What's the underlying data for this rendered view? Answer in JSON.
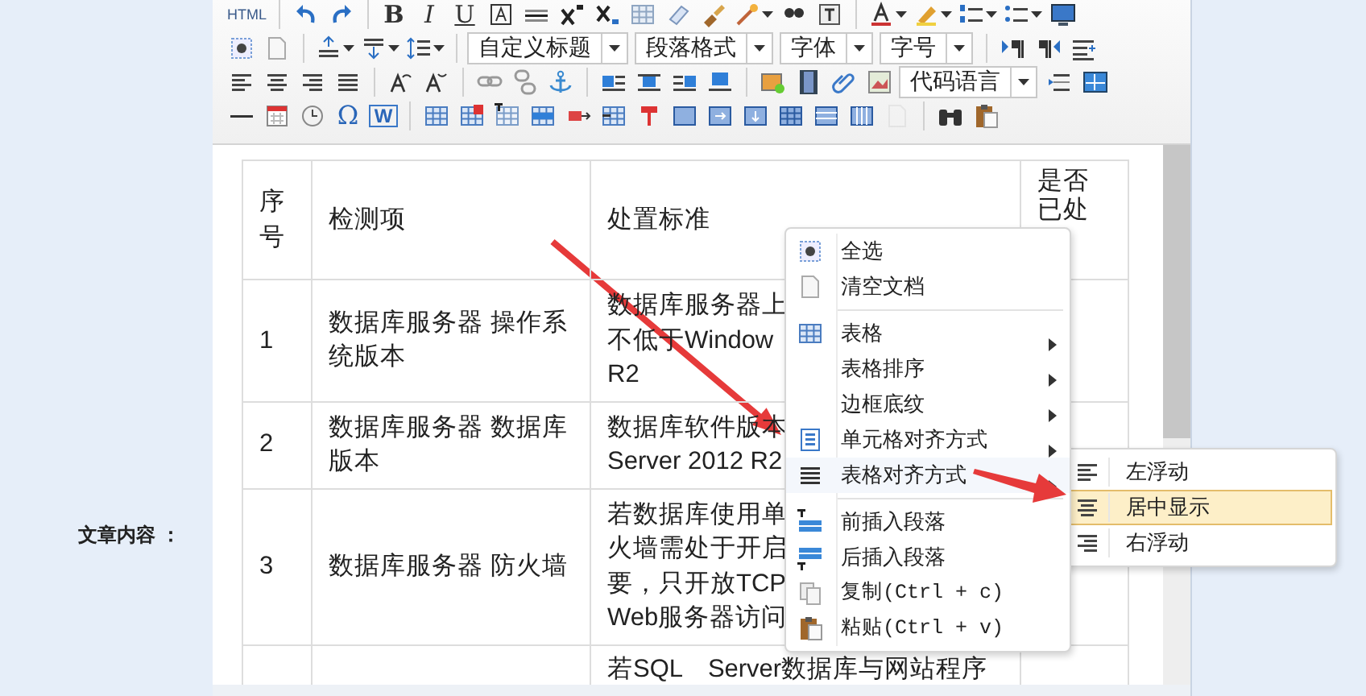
{
  "side_label": "文章内容 ：",
  "toolbar": [
    {
      "items": [
        {
          "kind": "text",
          "label": "HTML"
        },
        {
          "kind": "sep"
        },
        {
          "kind": "button"
        },
        {
          "kind": "button"
        },
        {
          "kind": "sep"
        },
        {
          "kind": "text",
          "label": "B"
        },
        {
          "kind": "text",
          "label": "I"
        },
        {
          "kind": "text",
          "label": "U"
        },
        {
          "kind": "button"
        },
        {
          "kind": "button"
        },
        {
          "kind": "button"
        },
        {
          "kind": "button"
        },
        {
          "kind": "button"
        },
        {
          "kind": "button"
        },
        {
          "kind": "button"
        },
        {
          "kind": "button",
          "caret": true
        },
        {
          "kind": "button"
        },
        {
          "kind": "button"
        },
        {
          "kind": "sep"
        },
        {
          "kind": "button",
          "caret": true
        },
        {
          "kind": "button",
          "caret": true
        },
        {
          "kind": "button",
          "caret": true
        },
        {
          "kind": "button",
          "caret": true
        },
        {
          "kind": "button"
        }
      ]
    },
    {
      "items": [
        {
          "kind": "button"
        },
        {
          "kind": "button"
        },
        {
          "kind": "sep"
        },
        {
          "kind": "button",
          "caret": true
        },
        {
          "kind": "button",
          "caret": true
        },
        {
          "kind": "button",
          "caret": true
        },
        {
          "kind": "sep"
        },
        {
          "kind": "dropdown",
          "value": "自定义标题"
        },
        {
          "kind": "dropdown",
          "value": "段落格式"
        },
        {
          "kind": "dropdown",
          "value": "字体"
        },
        {
          "kind": "dropdown",
          "value": "字号"
        },
        {
          "kind": "sep"
        },
        {
          "kind": "button"
        },
        {
          "kind": "button"
        },
        {
          "kind": "button"
        }
      ]
    },
    {
      "items": [
        {
          "kind": "button"
        },
        {
          "kind": "button"
        },
        {
          "kind": "button"
        },
        {
          "kind": "button"
        },
        {
          "kind": "sep"
        },
        {
          "kind": "button"
        },
        {
          "kind": "button"
        },
        {
          "kind": "sep"
        },
        {
          "kind": "button"
        },
        {
          "kind": "button"
        },
        {
          "kind": "button"
        },
        {
          "kind": "sep"
        },
        {
          "kind": "button"
        },
        {
          "kind": "button"
        },
        {
          "kind": "button"
        },
        {
          "kind": "button"
        },
        {
          "kind": "sep"
        },
        {
          "kind": "button"
        },
        {
          "kind": "button"
        },
        {
          "kind": "button"
        },
        {
          "kind": "button"
        },
        {
          "kind": "dropdown",
          "value": "代码语言"
        },
        {
          "kind": "button"
        },
        {
          "kind": "button"
        }
      ]
    },
    {
      "items": [
        {
          "kind": "button"
        },
        {
          "kind": "button"
        },
        {
          "kind": "button"
        },
        {
          "kind": "text",
          "label": "Ω"
        },
        {
          "kind": "text",
          "label": "W",
          "boxed": true
        },
        {
          "kind": "sep"
        },
        {
          "kind": "button"
        },
        {
          "kind": "button"
        },
        {
          "kind": "button"
        },
        {
          "kind": "button"
        },
        {
          "kind": "button"
        },
        {
          "kind": "button"
        },
        {
          "kind": "button"
        },
        {
          "kind": "button"
        },
        {
          "kind": "button"
        },
        {
          "kind": "button"
        },
        {
          "kind": "button"
        },
        {
          "kind": "button"
        },
        {
          "kind": "button"
        },
        {
          "kind": "button",
          "disabled": true
        },
        {
          "kind": "sep"
        },
        {
          "kind": "button"
        },
        {
          "kind": "button"
        }
      ]
    }
  ],
  "table": {
    "columns": [
      "序号",
      "检测项",
      "处置标准",
      "是否已处"
    ],
    "rows": [
      [
        [
          "1"
        ],
        [
          "数据库服务器 操作系统版本"
        ],
        [
          "数据库服务器上",
          "不低于Window",
          "R2"
        ],
        []
      ],
      [
        [
          "2"
        ],
        [
          "数据库服务器 数据库版本"
        ],
        [
          "数据库软件版本",
          "Server 2012 R2"
        ],
        []
      ],
      [
        [
          "3"
        ],
        [
          "数据库服务器 防火墙"
        ],
        [
          "若数据库使用单",
          "火墙需处于开启",
          "要，只开放TCP",
          "Web服务器访问"
        ],
        []
      ],
      [
        [],
        [],
        [
          "若SQL　Server数据库与网站程序"
        ],
        []
      ]
    ]
  },
  "context_menu": {
    "items": [
      {
        "kind": "item",
        "label": "全选",
        "submenu": false
      },
      {
        "kind": "item",
        "label": "清空文档",
        "submenu": false
      },
      {
        "kind": "separator"
      },
      {
        "kind": "item",
        "label": "表格",
        "submenu": true,
        "expanded": false
      },
      {
        "kind": "item",
        "label": "表格排序",
        "submenu": true,
        "expanded": false
      },
      {
        "kind": "item",
        "label": "边框底纹",
        "submenu": true,
        "expanded": false
      },
      {
        "kind": "item",
        "label": "单元格对齐方式",
        "submenu": true,
        "expanded": false
      },
      {
        "kind": "item",
        "label": "表格对齐方式",
        "submenu": true,
        "expanded": true,
        "children": [
          {
            "label": "左浮动",
            "selected": false
          },
          {
            "label": "居中显示",
            "selected": true
          },
          {
            "label": "右浮动",
            "selected": false
          }
        ]
      },
      {
        "kind": "separator"
      },
      {
        "kind": "item",
        "label": "前插入段落",
        "submenu": false
      },
      {
        "kind": "item",
        "label": "后插入段落",
        "submenu": false
      },
      {
        "kind": "item",
        "label": "复制(Ctrl + c)",
        "submenu": false,
        "mono": true
      },
      {
        "kind": "item",
        "label": "粘贴(Ctrl + v)",
        "submenu": false,
        "mono": true
      }
    ]
  }
}
